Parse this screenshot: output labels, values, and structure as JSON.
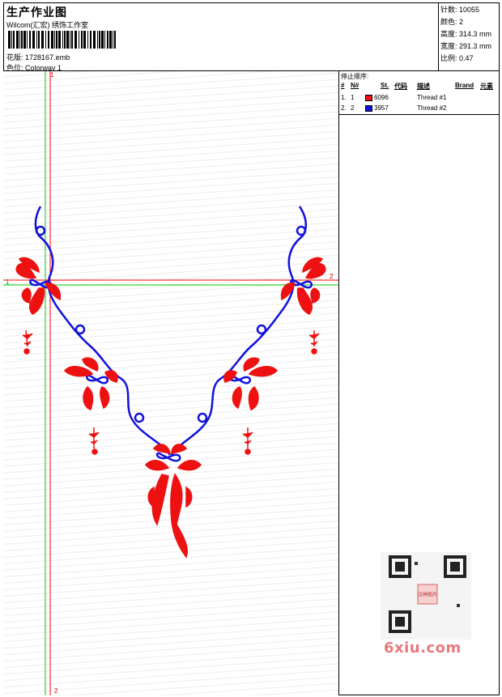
{
  "header": {
    "title": "生产作业图",
    "software": "Wilcom(汇宏) 绣饰工作室",
    "pattern_label": "花版:",
    "pattern_value": "1728167.emb",
    "colorway_label": "色位:",
    "colorway_value": "Colorway 1"
  },
  "stats": {
    "stitches_label": "针数:",
    "stitches_value": "10055",
    "colors_label": "颜色:",
    "colors_value": "2",
    "height_label": "高度:",
    "height_value": "314.3 mm",
    "width_label": "宽度:",
    "width_value": "291.3 mm",
    "scale_label": "比例:",
    "scale_value": "0.47"
  },
  "stop_sequence": {
    "title": "停止顺序:",
    "headers": {
      "num": "#",
      "n": "N#",
      "st": "St.",
      "code": "代码",
      "desc": "描述",
      "brand": "Brand",
      "element": "元素"
    },
    "rows": [
      {
        "num": "1.",
        "n": "1",
        "color": "#ee1111",
        "code": "6096",
        "desc": "Thread #1"
      },
      {
        "num": "2.",
        "n": "2",
        "color": "#1111dd",
        "code": "3957",
        "desc": "Thread #2"
      }
    ]
  },
  "guides": {
    "h_label_left": "1",
    "h_label_right": "2",
    "v_label_top": "1",
    "v_label_bottom": "2"
  },
  "watermark": "6xiu.com",
  "qr_stamp": "汉神图片",
  "colors": {
    "thread1": "#ee1111",
    "thread2": "#1111dd",
    "guide_red": "#ff0000",
    "guide_green": "#00cc00"
  }
}
